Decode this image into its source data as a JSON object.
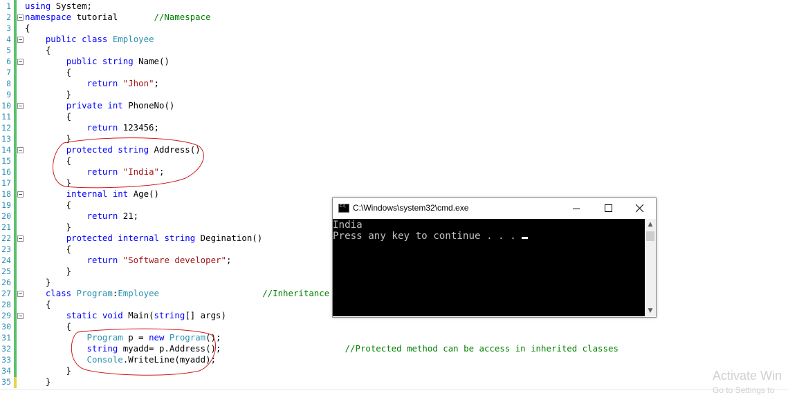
{
  "editor": {
    "lines": [
      {
        "n": "1",
        "segs": [
          {
            "t": "using",
            "c": "kw"
          },
          {
            "t": " System;"
          }
        ]
      },
      {
        "n": "2",
        "fold": true,
        "segs": [
          {
            "t": "namespace",
            "c": "kw"
          },
          {
            "t": " tutorial       "
          },
          {
            "t": "//Namespace",
            "c": "cm"
          }
        ]
      },
      {
        "n": "3",
        "segs": [
          {
            "t": "{"
          }
        ]
      },
      {
        "n": "4",
        "fold": true,
        "segs": [
          {
            "t": "    "
          },
          {
            "t": "public",
            "c": "kw"
          },
          {
            "t": " "
          },
          {
            "t": "class",
            "c": "kw"
          },
          {
            "t": " "
          },
          {
            "t": "Employee",
            "c": "ty"
          }
        ]
      },
      {
        "n": "5",
        "segs": [
          {
            "t": "    {"
          }
        ]
      },
      {
        "n": "6",
        "fold": true,
        "segs": [
          {
            "t": "        "
          },
          {
            "t": "public",
            "c": "kw"
          },
          {
            "t": " "
          },
          {
            "t": "string",
            "c": "kw"
          },
          {
            "t": " Name()"
          }
        ]
      },
      {
        "n": "7",
        "segs": [
          {
            "t": "        {"
          }
        ]
      },
      {
        "n": "8",
        "segs": [
          {
            "t": "            "
          },
          {
            "t": "return",
            "c": "kw"
          },
          {
            "t": " "
          },
          {
            "t": "\"Jhon\"",
            "c": "st"
          },
          {
            "t": ";"
          }
        ]
      },
      {
        "n": "9",
        "segs": [
          {
            "t": "        }"
          }
        ]
      },
      {
        "n": "10",
        "fold": true,
        "segs": [
          {
            "t": "        "
          },
          {
            "t": "private",
            "c": "kw"
          },
          {
            "t": " "
          },
          {
            "t": "int",
            "c": "kw"
          },
          {
            "t": " PhoneNo()"
          }
        ]
      },
      {
        "n": "11",
        "segs": [
          {
            "t": "        {"
          }
        ]
      },
      {
        "n": "12",
        "segs": [
          {
            "t": "            "
          },
          {
            "t": "return",
            "c": "kw"
          },
          {
            "t": " 123456;"
          }
        ]
      },
      {
        "n": "13",
        "segs": [
          {
            "t": "        }"
          }
        ]
      },
      {
        "n": "14",
        "fold": true,
        "segs": [
          {
            "t": "        "
          },
          {
            "t": "protected",
            "c": "kw"
          },
          {
            "t": " "
          },
          {
            "t": "string",
            "c": "kw"
          },
          {
            "t": " Address()"
          }
        ]
      },
      {
        "n": "15",
        "segs": [
          {
            "t": "        {"
          }
        ]
      },
      {
        "n": "16",
        "segs": [
          {
            "t": "            "
          },
          {
            "t": "return",
            "c": "kw"
          },
          {
            "t": " "
          },
          {
            "t": "\"India\"",
            "c": "st"
          },
          {
            "t": ";"
          }
        ]
      },
      {
        "n": "17",
        "segs": [
          {
            "t": "        }"
          }
        ]
      },
      {
        "n": "18",
        "fold": true,
        "segs": [
          {
            "t": "        "
          },
          {
            "t": "internal",
            "c": "kw"
          },
          {
            "t": " "
          },
          {
            "t": "int",
            "c": "kw"
          },
          {
            "t": " Age()"
          }
        ]
      },
      {
        "n": "19",
        "segs": [
          {
            "t": "        {"
          }
        ]
      },
      {
        "n": "20",
        "segs": [
          {
            "t": "            "
          },
          {
            "t": "return",
            "c": "kw"
          },
          {
            "t": " 21;"
          }
        ]
      },
      {
        "n": "21",
        "segs": [
          {
            "t": "        }"
          }
        ]
      },
      {
        "n": "22",
        "fold": true,
        "segs": [
          {
            "t": "        "
          },
          {
            "t": "protected",
            "c": "kw"
          },
          {
            "t": " "
          },
          {
            "t": "internal",
            "c": "kw"
          },
          {
            "t": " "
          },
          {
            "t": "string",
            "c": "kw"
          },
          {
            "t": " Degination()"
          }
        ]
      },
      {
        "n": "23",
        "segs": [
          {
            "t": "        {"
          }
        ]
      },
      {
        "n": "24",
        "segs": [
          {
            "t": "            "
          },
          {
            "t": "return",
            "c": "kw"
          },
          {
            "t": " "
          },
          {
            "t": "\"Software developer\"",
            "c": "st"
          },
          {
            "t": ";"
          }
        ]
      },
      {
        "n": "25",
        "segs": [
          {
            "t": "        }"
          }
        ]
      },
      {
        "n": "26",
        "segs": [
          {
            "t": "    }"
          }
        ]
      },
      {
        "n": "27",
        "fold": true,
        "segs": [
          {
            "t": "    "
          },
          {
            "t": "class",
            "c": "kw"
          },
          {
            "t": " "
          },
          {
            "t": "Program",
            "c": "ty"
          },
          {
            "t": ":"
          },
          {
            "t": "Employee",
            "c": "ty"
          },
          {
            "t": "                    "
          },
          {
            "t": "//Inheritance",
            "c": "cm"
          }
        ]
      },
      {
        "n": "28",
        "segs": [
          {
            "t": "    {"
          }
        ]
      },
      {
        "n": "29",
        "fold": true,
        "segs": [
          {
            "t": "        "
          },
          {
            "t": "static",
            "c": "kw"
          },
          {
            "t": " "
          },
          {
            "t": "void",
            "c": "kw"
          },
          {
            "t": " Main("
          },
          {
            "t": "string",
            "c": "kw"
          },
          {
            "t": "[] args)"
          }
        ]
      },
      {
        "n": "30",
        "segs": [
          {
            "t": "        {"
          }
        ]
      },
      {
        "n": "31",
        "segs": [
          {
            "t": "            "
          },
          {
            "t": "Program",
            "c": "ty"
          },
          {
            "t": " p = "
          },
          {
            "t": "new",
            "c": "kw"
          },
          {
            "t": " "
          },
          {
            "t": "Program",
            "c": "ty"
          },
          {
            "t": "();"
          }
        ]
      },
      {
        "n": "32",
        "segs": [
          {
            "t": "            "
          },
          {
            "t": "string",
            "c": "kw"
          },
          {
            "t": " myadd= p.Address();                        "
          },
          {
            "t": "//Protected method can be access in inherited classes",
            "c": "cm"
          }
        ]
      },
      {
        "n": "33",
        "segs": [
          {
            "t": "            "
          },
          {
            "t": "Console",
            "c": "ty"
          },
          {
            "t": ".WriteLine(myadd);"
          }
        ]
      },
      {
        "n": "34",
        "segs": [
          {
            "t": "        }"
          }
        ]
      },
      {
        "n": "35",
        "segs": [
          {
            "t": "    }"
          }
        ]
      }
    ]
  },
  "console": {
    "title": "C:\\Windows\\system32\\cmd.exe",
    "output_line1": "India",
    "output_line2": "Press any key to continue . . .",
    "icon": "cmd-icon",
    "scroll_up": "▲",
    "scroll_down": "▼"
  },
  "watermark": {
    "line1": "Activate Win",
    "line2": "Go to Settings to"
  },
  "colors": {
    "keyword": "#0000ff",
    "type": "#2b91af",
    "string": "#a31515",
    "comment": "#008000",
    "line_number": "#2b91af",
    "change_bar": "#57c26a",
    "annotation": "#d0191c"
  }
}
